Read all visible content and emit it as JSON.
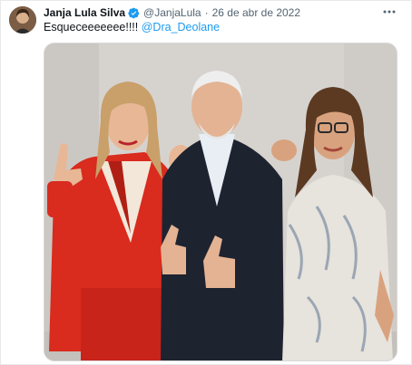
{
  "tweet": {
    "author_name": "Janja Lula Silva",
    "author_handle": "@JanjaLula",
    "separator": "·",
    "date": "26 de abr de 2022",
    "text": "Esqueceeeeeee!!!! ",
    "mention": "@Dra_Deolane",
    "more_glyph": "···"
  },
  "icons": {
    "avatar": "profile-avatar",
    "verified": "verified-badge-icon",
    "more": "more-options-icon"
  },
  "colors": {
    "link": "#1d9bf0",
    "secondary_text": "#536471",
    "verified": "#1d9bf0"
  }
}
